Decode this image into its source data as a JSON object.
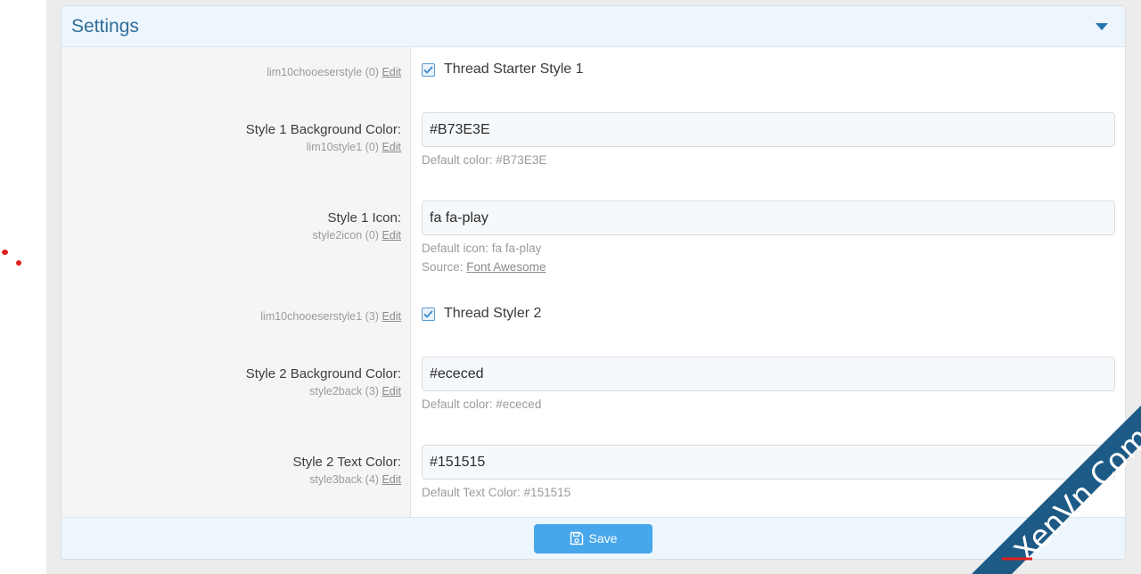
{
  "panel": {
    "title": "Settings",
    "collapse_icon": "caret-down-icon"
  },
  "options": [
    {
      "type": "checkbox",
      "label": "",
      "option_id": "lim10chooeserstyle (0)",
      "edit_label": "Edit",
      "checkbox_label": "Thread Starter Style 1",
      "checked": true
    },
    {
      "type": "text",
      "label": "Style 1 Background Color:",
      "option_id": "lim10style1 (0)",
      "edit_label": "Edit",
      "value": "#B73E3E",
      "hint": "Default color: #B73E3E"
    },
    {
      "type": "text",
      "label": "Style 1 Icon:",
      "option_id": "style2icon (0)",
      "edit_label": "Edit",
      "value": "fa fa-play",
      "hint": "Default icon: fa fa-play",
      "source_prefix": "Source: ",
      "source_link": "Font Awesome"
    },
    {
      "type": "checkbox",
      "label": "",
      "option_id": "lim10chooeserstyle1 (3)",
      "edit_label": "Edit",
      "checkbox_label": "Thread Styler 2",
      "checked": true
    },
    {
      "type": "text",
      "label": "Style 2 Background Color:",
      "option_id": "style2back (3)",
      "edit_label": "Edit",
      "value": "#ececed",
      "hint": "Default color: #ececed"
    },
    {
      "type": "text",
      "label": "Style 2 Text Color:",
      "option_id": "style3back (4)",
      "edit_label": "Edit",
      "value": "#151515",
      "hint": "Default Text Color: #151515"
    }
  ],
  "footer": {
    "save_label": "Save",
    "save_icon": "floppy-disk-icon"
  },
  "watermark": {
    "text": "XenVn.Com",
    "color": "#1d5a86"
  },
  "colors": {
    "accent": "#47a7eb",
    "header_bg": "#edf6fd",
    "title": "#2f6d99"
  }
}
